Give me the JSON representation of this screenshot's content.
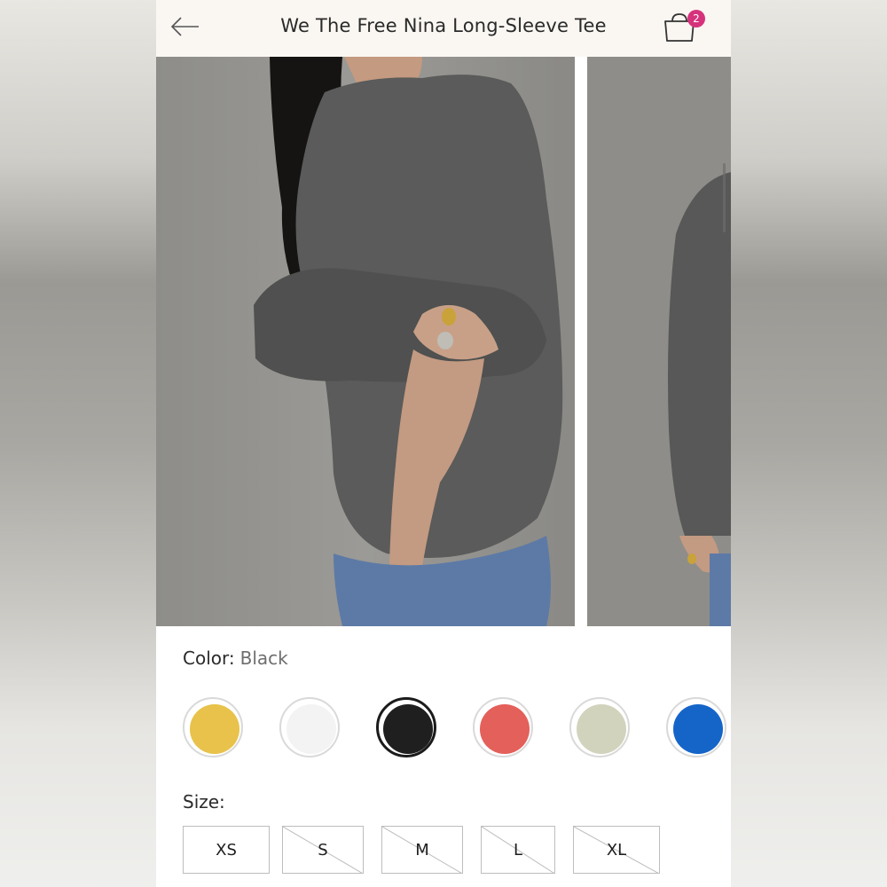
{
  "header": {
    "title": "We The Free Nina Long-Sleeve Tee",
    "back_icon": "back-arrow-icon",
    "bag_icon": "shopping-bag-icon",
    "bag_count": "2"
  },
  "gallery": {
    "images": [
      "main-product-photo",
      "next-product-photo"
    ]
  },
  "color": {
    "label": "Color:",
    "selected_value": "Black",
    "swatches": [
      {
        "name": "yellow",
        "hex": "#e8c24a",
        "selected": false
      },
      {
        "name": "white",
        "hex": "#f3f3f3",
        "selected": false
      },
      {
        "name": "black",
        "hex": "#1f1f1f",
        "selected": true
      },
      {
        "name": "red",
        "hex": "#e4605a",
        "selected": false
      },
      {
        "name": "sage",
        "hex": "#d2d3bd",
        "selected": false
      },
      {
        "name": "blue",
        "hex": "#1565c9",
        "selected": false
      }
    ]
  },
  "size": {
    "label": "Size:",
    "options": [
      {
        "label": "XS",
        "available": true
      },
      {
        "label": "S",
        "available": false
      },
      {
        "label": "M",
        "available": false
      },
      {
        "label": "L",
        "available": false
      },
      {
        "label": "XL",
        "available": false
      }
    ]
  },
  "colors": {
    "accent": "#d6337c",
    "header_bg": "#faf7f2",
    "text": "#2a2a2a"
  }
}
